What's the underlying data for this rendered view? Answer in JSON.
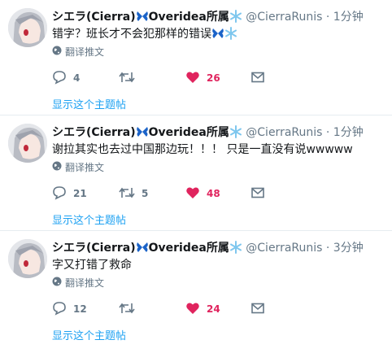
{
  "tweets": [
    {
      "name": "シエラ(Cierra)",
      "org": "Overidea所属",
      "handle": "@CierraRunis",
      "dot": "·",
      "time": "1分钟",
      "text": "错字？班长才不会犯那样的错误",
      "translate_label": "翻译推文",
      "replies": "4",
      "retweets": "",
      "likes": "26",
      "thread_link": "显示这个主题帖"
    },
    {
      "name": "シエラ(Cierra)",
      "org": "Overidea所属",
      "handle": "@CierraRunis",
      "dot": "·",
      "time": "1分钟",
      "text": "谢拉其实也去过中国那边玩！！！ 只是一直没有说wwwww",
      "translate_label": "翻译推文",
      "replies": "21",
      "retweets": "5",
      "likes": "48",
      "thread_link": "显示这个主题帖"
    },
    {
      "name": "シエラ(Cierra)",
      "org": "Overidea所属",
      "handle": "@CierraRunis",
      "dot": "·",
      "time": "3分钟",
      "text": "字又打错了救命",
      "translate_label": "翻译推文",
      "replies": "12",
      "retweets": "",
      "likes": "24",
      "thread_link": "显示这个主题帖"
    }
  ],
  "colors": {
    "like": "#e0245e",
    "link": "#1da1f2",
    "muted": "#657786",
    "butterfly": "#1b63c8",
    "snowflake": "#7fc7ee"
  }
}
